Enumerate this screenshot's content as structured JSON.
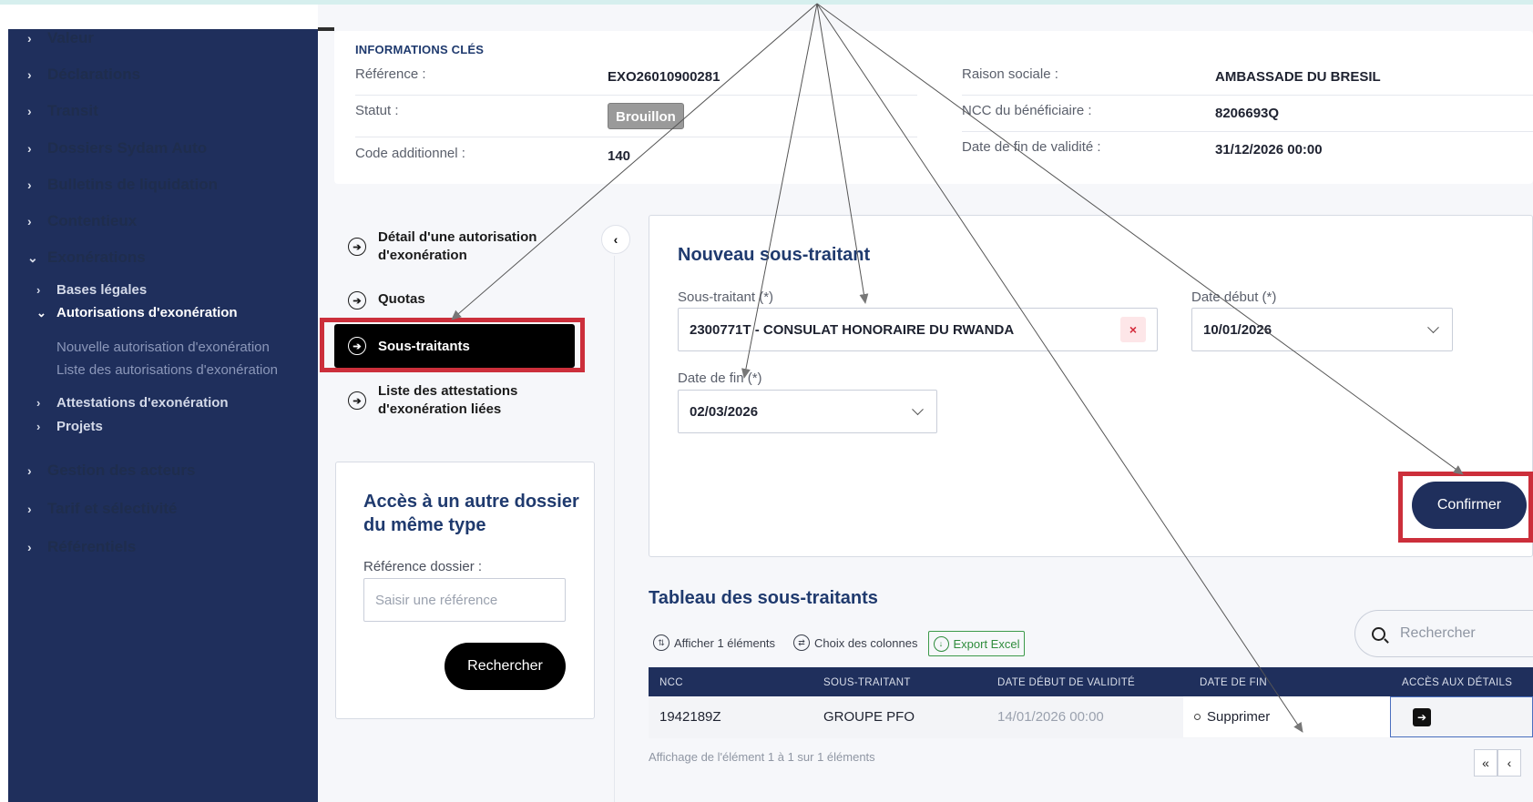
{
  "sidebar": {
    "items": [
      {
        "label": "Valeur",
        "chevron": "›"
      },
      {
        "label": "Déclarations",
        "chevron": "›"
      },
      {
        "label": "Transit",
        "chevron": "›"
      },
      {
        "label": "Dossiers Sydam Auto",
        "chevron": "›"
      },
      {
        "label": "Bulletins de liquidation",
        "chevron": "›"
      },
      {
        "label": "Contentieux",
        "chevron": "›"
      },
      {
        "label": "Exonérations",
        "chevron": "⌄"
      },
      {
        "label": "Gestion des acteurs",
        "chevron": "›"
      },
      {
        "label": "Tarif et sélectivité",
        "chevron": "›"
      },
      {
        "label": "Référentiels",
        "chevron": "›"
      }
    ],
    "sub_items": [
      {
        "label": "Bases légales",
        "chevron": "›"
      },
      {
        "label": "Autorisations d'exonération",
        "chevron": "⌄"
      },
      {
        "label": "Attestations d'exonération",
        "chevron": "›"
      },
      {
        "label": "Projets",
        "chevron": "›"
      }
    ],
    "leaf_items": [
      {
        "label": "Nouvelle autorisation d'exonération"
      },
      {
        "label": "Liste des autorisations d'exonération"
      }
    ]
  },
  "info": {
    "title": "INFORMATIONS CLÉS",
    "reference_label": "Référence :",
    "reference_value": "EXO26010900281",
    "statut_label": "Statut :",
    "statut_value": "Brouillon",
    "code_label": "Code additionnel :",
    "code_value": "140",
    "raison_label": "Raison sociale :",
    "raison_value": "AMBASSADE DU BRESIL",
    "ncc_label": "NCC du bénéficiaire :",
    "ncc_value": "8206693Q",
    "date_fin_label": "Date de fin de validité :",
    "date_fin_value": "31/12/2026 00:00"
  },
  "nav": {
    "detail_line1": "Détail d'une autorisation",
    "detail_line2": "d'exonération",
    "quotas": "Quotas",
    "sous_traitants": "Sous-traitants",
    "attest_line1": "Liste des attestations",
    "attest_line2": "d'exonération liées",
    "icon": "➔",
    "collapse_icon": "‹"
  },
  "access": {
    "title": "Accès à un autre dossier du même type",
    "ref_label": "Référence dossier :",
    "ref_placeholder": "Saisir une référence",
    "search_button": "Rechercher"
  },
  "form": {
    "title": "Nouveau sous-traitant",
    "sous_traitant_label": "Sous-traitant (*)",
    "sous_traitant_value": "2300771T - CONSULAT HONORAIRE DU RWANDA",
    "clear_icon": "×",
    "date_debut_label": "Date début (*)",
    "date_debut_value": "10/01/2026",
    "date_fin_label": "Date de fin (*)",
    "date_fin_value": "02/03/2026",
    "confirm_button": "Confirmer"
  },
  "table": {
    "title": "Tableau des sous-traitants",
    "tool_afficher": "Afficher 1 éléments",
    "tool_colonnes": "Choix des colonnes",
    "export": "Export Excel",
    "search_placeholder": "Rechercher",
    "columns": [
      "NCC",
      "SOUS-TRAITANT",
      "DATE DÉBUT DE VALIDITÉ",
      "DATE DE FIN",
      "ACCÈS AUX DÉTAILS"
    ],
    "rows": [
      {
        "ncc": "1942189Z",
        "sous_traitant": "GROUPE PFO",
        "date_debut": "14/01/2026 00:00"
      }
    ],
    "popup_action": "Supprimer",
    "detail_icon": "➔",
    "footer": "Affichage de l'élément 1 à 1 sur 1 éléments",
    "pager_first": "«",
    "pager_prev": "‹"
  },
  "colors": {
    "sidebar": "#1f2f5c",
    "accent_navy": "#1f2f5c",
    "highlight_red": "#cc2f3b",
    "export_green": "#2f8c3d"
  }
}
